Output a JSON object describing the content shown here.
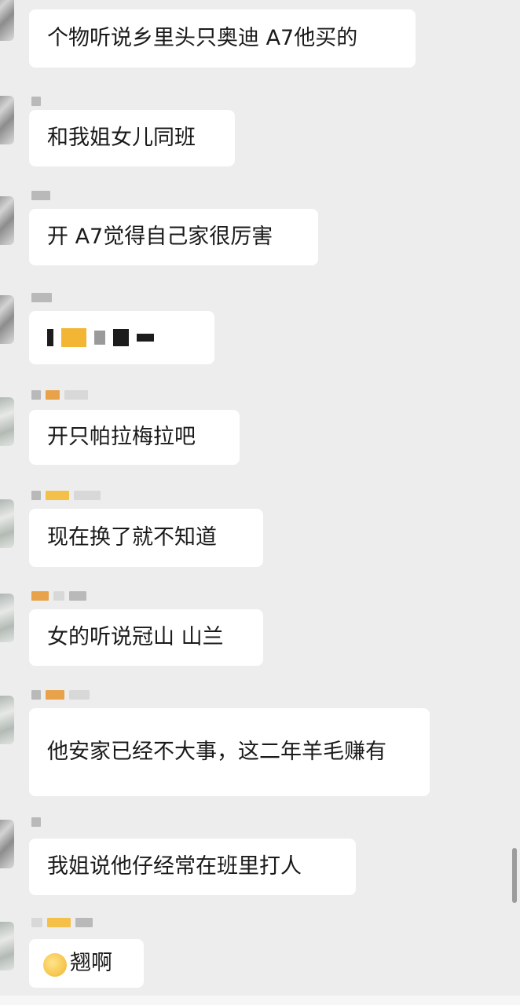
{
  "messages": [
    {
      "text": "个物听说乡里头只奥迪 A7他买的"
    },
    {
      "text": "和我姐女儿同班"
    },
    {
      "text": "开 A7觉得自己家很厉害"
    },
    {
      "text": ""
    },
    {
      "text": "开只帕拉梅拉吧"
    },
    {
      "text": "现在换了就不知道"
    },
    {
      "text": "女的听说冠山 山兰"
    },
    {
      "text": "他安家已经不大事，这二年羊毛赚有"
    },
    {
      "text": "我姐说他仔经常在班里打人"
    },
    {
      "text": "翘啊",
      "emoji": "crying-laughing-face"
    }
  ],
  "colors": {
    "background": "#ededed",
    "bubble": "#ffffff",
    "text": "#1a1a1a"
  }
}
